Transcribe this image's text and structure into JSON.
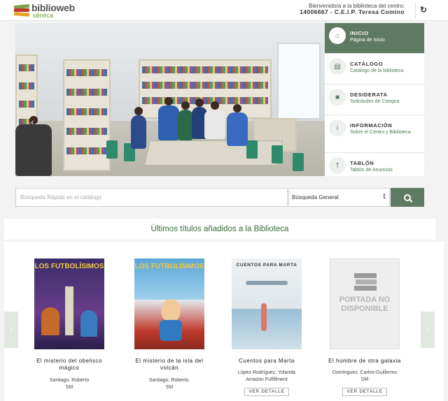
{
  "header": {
    "logo_main": "biblioweb",
    "logo_sub": "séneca",
    "welcome": "Bienvenido/a a la biblioteca del centro:",
    "center_name": "14006667 - C.E.I.P. Teresa Comino",
    "refresh_icon": "refresh-icon"
  },
  "menu": {
    "items": [
      {
        "title": "INICIO",
        "subtitle": "Página de Inicio",
        "icon": "home-icon"
      },
      {
        "title": "CATÁLOGO",
        "subtitle": "Catálogo de la biblioteca",
        "icon": "book-icon"
      },
      {
        "title": "DESIDERATA",
        "subtitle": "Solicitudes de Compra",
        "icon": "cart-icon"
      },
      {
        "title": "INFORMACIÓN",
        "subtitle": "Sobre el Centro y Biblioteca",
        "icon": "info-icon"
      },
      {
        "title": "TABLÓN",
        "subtitle": "Tablón de Anuncios",
        "icon": "pin-icon"
      }
    ]
  },
  "search": {
    "placeholder": "Búsqueda Rápida en el catálogo",
    "value": "",
    "select_value": "Búsqueda General"
  },
  "section": {
    "title": "Últimos títulos añadidos a la Biblioteca"
  },
  "books": [
    {
      "title": "El misterio del obelisco mágico",
      "author": "Santiago, Roberto",
      "publisher": "SM",
      "cover_text": "LOS FUTBOLÍSIMOS",
      "has_button": false,
      "button": ""
    },
    {
      "title": "El misterio de la isla del volcán",
      "author": "Santiago, Roberto.",
      "publisher": "SM",
      "cover_text": "LOS FUTBOLÍSIMOS",
      "has_button": false,
      "button": ""
    },
    {
      "title": "Cuentos para Marta",
      "author": "López Rodríguez, Yolanda",
      "publisher": "Amazon Fulfillment",
      "cover_text": "CUENTOS PARA MARTA",
      "has_button": true,
      "button": "VER DETALLE"
    },
    {
      "title": "El hombre de otra galaxia",
      "author": "Domínguez, Carlos-Guillermo",
      "publisher": "SM",
      "cover_text": "PORTADA NO DISPONIBLE",
      "has_button": true,
      "button": "VER DETALLE"
    }
  ],
  "colors": {
    "accent": "#5f7a63",
    "accent_text": "#3a6b40"
  }
}
